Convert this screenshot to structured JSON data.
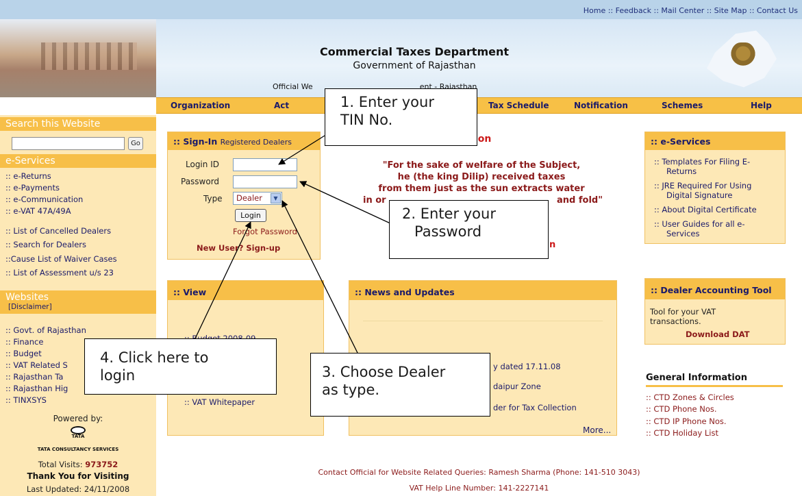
{
  "top_links": "Home :: Feedback :: Mail Center :: Site Map :: Contact Us",
  "header": {
    "title": "Commercial Taxes Department",
    "subtitle": "Government of Rajasthan",
    "tagline_left": "Official We",
    "tagline_right": "ent - Rajasthan"
  },
  "nav": [
    "Organization",
    "Act",
    "Tax Schedule",
    "Notification",
    "Schemes",
    "Help"
  ],
  "sidebar": {
    "search_head": "Search this Website",
    "go_label": "Go",
    "eservices_head": "e-Services",
    "eservices": [
      ":: e-Returns",
      ":: e-Payments",
      ":: e-Communication",
      ":: e-VAT 47A/49A"
    ],
    "dealers": [
      ":: List of Cancelled Dealers",
      ":: Search for Dealers",
      "::Cause List of Waiver Cases",
      ":: List of Assessment u/s 23"
    ],
    "websites_head": "Websites",
    "disclaimer": "[Disclaimer]",
    "websites": [
      ":: Govt. of Rajasthan",
      ":: Finance",
      ":: Budget",
      ":: VAT Related S",
      ":: Rajasthan Ta",
      ":: Rajasthan Hig",
      ":: TINXSYS"
    ],
    "powered_by": "Powered by:",
    "tcs_logo_top": "TATA",
    "tcs_logo_text": "TATA CONSULTANCY SERVICES",
    "total_visits_label": "Total Visits:",
    "total_visits_value": "973752",
    "thank_you": "Thank You for Visiting",
    "last_updated": "Last Updated: 24/11/2008"
  },
  "signin": {
    "head_bold": ":: Sign-In",
    "head_rest": "Registered Dealers",
    "login_id_label": "Login ID",
    "password_label": "Password",
    "type_label": "Type",
    "type_value": "Dealer",
    "login_button": "Login",
    "forgot_password": "Forgot Password",
    "new_user": "New User? Sign-up"
  },
  "quote": {
    "heading_fragment": "ion",
    "lines": [
      "\"For the sake of welfare of the Subject,",
      "he (the king Dilip) received taxes",
      "from them just as the sun extracts water",
      "in or",
      "and fold\""
    ],
    "trailing_fragment": "n"
  },
  "view_box": {
    "head": ":: View",
    "items": [
      ":: Budget 2008-09",
      ":: VAT Whitepaper"
    ]
  },
  "news_box": {
    "head": ":: News and Updates",
    "items": [
      "y dated 17.11.08",
      "daipur Zone",
      "der for Tax Collection"
    ],
    "more": "More..."
  },
  "eservices_box": {
    "head": ":: e-Services",
    "items": [
      ":: Templates For Filing E-",
      "Returns",
      ":: JRE Required For Using",
      "Digital Signature",
      ":: About Digital Certificate",
      ":: User Guides for all e-",
      "Services"
    ]
  },
  "dat_box": {
    "head": ":: Dealer Accounting Tool",
    "text1": "Tool for your VAT",
    "text2": "transactions.",
    "download": "Download DAT"
  },
  "general_info": {
    "head": "General Information",
    "items": [
      ":: CTD Zones & Circles",
      ":: CTD Phone Nos.",
      ":: CTD IP Phone Nos.",
      ":: CTD Holiday List"
    ]
  },
  "footer": {
    "contact": "Contact Official for Website Related Queries: Ramesh Sharma (Phone: 141-510 3043)",
    "helpline": "VAT Help Line Number: 141-2227141"
  },
  "callouts": {
    "c1_line1": "1. Enter your",
    "c1_line2": "TIN No.",
    "c2_line1": "2. Enter your",
    "c2_line2": "Password",
    "c3_line1": "3. Choose Dealer",
    "c3_line2": "as type.",
    "c4_line1": "4. Click here to",
    "c4_line2": "login"
  },
  "colors": {
    "accent_orange": "#f7bf48",
    "panel_bg": "#fde8b6",
    "link_navy": "#1a1a6a",
    "quote_red": "#8b1a1a",
    "top_bar": "#b9d3e9"
  }
}
